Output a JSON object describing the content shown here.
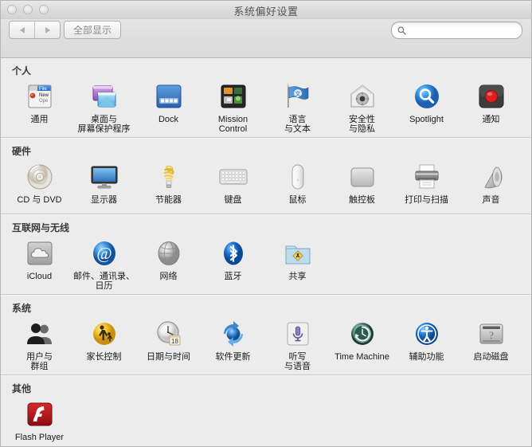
{
  "window": {
    "title": "系统偏好设置",
    "traffic_lights": [
      "close",
      "minimize",
      "zoom"
    ]
  },
  "toolbar": {
    "back_label": "",
    "forward_label": "",
    "show_all_label": "全部显示",
    "search_value": "",
    "search_placeholder": ""
  },
  "sections": [
    {
      "title": "个人",
      "items": [
        {
          "icon": "general-icon",
          "lines": [
            "通用"
          ]
        },
        {
          "icon": "desktop-saver-icon",
          "lines": [
            "桌面与",
            "屏幕保护程序"
          ]
        },
        {
          "icon": "dock-icon",
          "lines": [
            "Dock"
          ]
        },
        {
          "icon": "mission-control-icon",
          "lines": [
            "Mission",
            "Control"
          ]
        },
        {
          "icon": "language-text-icon",
          "lines": [
            "语言",
            "与文本"
          ]
        },
        {
          "icon": "security-privacy-icon",
          "lines": [
            "安全性",
            "与隐私"
          ]
        },
        {
          "icon": "spotlight-icon",
          "lines": [
            "Spotlight"
          ]
        },
        {
          "icon": "notifications-icon",
          "lines": [
            "通知"
          ]
        }
      ]
    },
    {
      "title": "硬件",
      "items": [
        {
          "icon": "cd-dvd-icon",
          "lines": [
            "CD 与 DVD"
          ]
        },
        {
          "icon": "displays-icon",
          "lines": [
            "显示器"
          ]
        },
        {
          "icon": "energy-saver-icon",
          "lines": [
            "节能器"
          ]
        },
        {
          "icon": "keyboard-icon",
          "lines": [
            "键盘"
          ]
        },
        {
          "icon": "mouse-icon",
          "lines": [
            "鼠标"
          ]
        },
        {
          "icon": "trackpad-icon",
          "lines": [
            "触控板"
          ]
        },
        {
          "icon": "print-scan-icon",
          "lines": [
            "打印与扫描"
          ]
        },
        {
          "icon": "sound-icon",
          "lines": [
            "声音"
          ]
        }
      ]
    },
    {
      "title": "互联网与无线",
      "items": [
        {
          "icon": "icloud-icon",
          "lines": [
            "iCloud"
          ]
        },
        {
          "icon": "mail-contacts-calendars-icon",
          "lines": [
            "邮件、通讯录、",
            "日历"
          ]
        },
        {
          "icon": "network-icon",
          "lines": [
            "网络"
          ]
        },
        {
          "icon": "bluetooth-icon",
          "lines": [
            "蓝牙"
          ]
        },
        {
          "icon": "sharing-icon",
          "lines": [
            "共享"
          ]
        }
      ]
    },
    {
      "title": "系统",
      "items": [
        {
          "icon": "users-groups-icon",
          "lines": [
            "用户与",
            "群组"
          ]
        },
        {
          "icon": "parental-controls-icon",
          "lines": [
            "家长控制"
          ]
        },
        {
          "icon": "date-time-icon",
          "lines": [
            "日期与时间"
          ],
          "badge": "18"
        },
        {
          "icon": "software-update-icon",
          "lines": [
            "软件更新"
          ]
        },
        {
          "icon": "dictation-speech-icon",
          "lines": [
            "听写",
            "与语音"
          ]
        },
        {
          "icon": "time-machine-icon",
          "lines": [
            "Time Machine"
          ]
        },
        {
          "icon": "accessibility-icon",
          "lines": [
            "辅助功能"
          ]
        },
        {
          "icon": "startup-disk-icon",
          "lines": [
            "启动磁盘"
          ]
        }
      ]
    },
    {
      "title": "其他",
      "items": [
        {
          "icon": "flash-player-icon",
          "lines": [
            "Flash Player"
          ]
        }
      ]
    }
  ],
  "colors": {
    "window_bg": "#ececec",
    "separator": "#c9c9c9",
    "title_text": "#555555",
    "label_text": "#1a1a1a",
    "spotlight_blue": "#2f8fe8",
    "bluetooth_blue": "#1c6fd0",
    "flash_red": "#c4161c",
    "notification_red": "#e02020",
    "parental_yellow": "#f5c02a"
  }
}
